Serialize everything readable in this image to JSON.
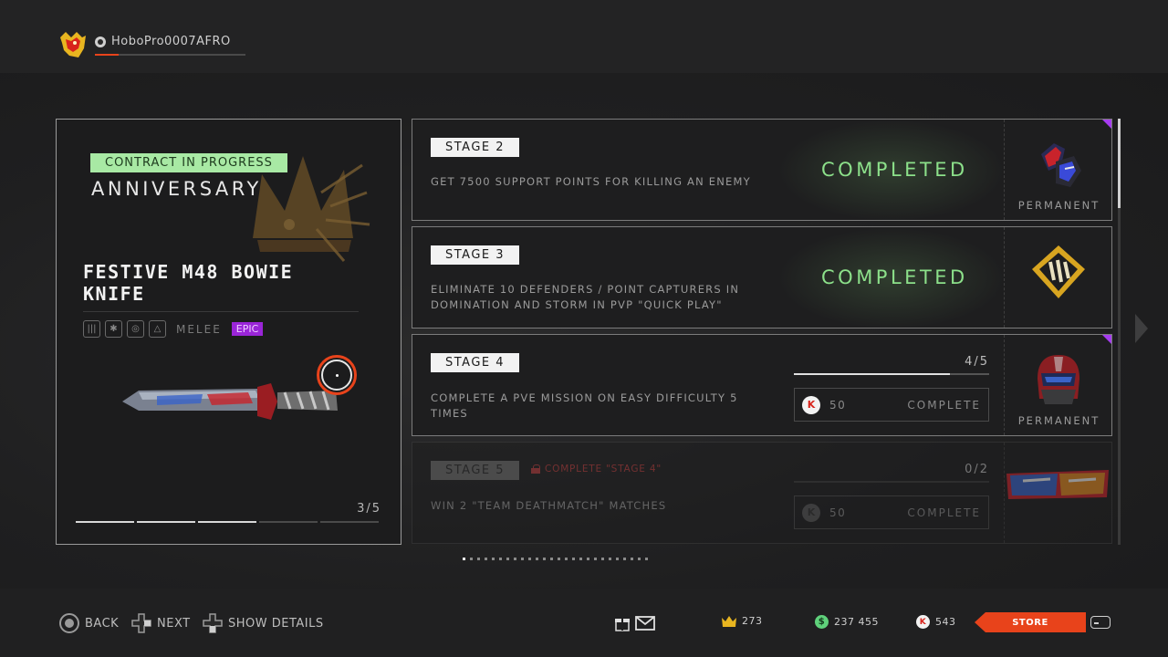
{
  "header": {
    "username": "HoboPro0007AFRO",
    "xp_progress": 0.16
  },
  "contract": {
    "status_badge": "CONTRACT IN PROGRESS",
    "event_name": "ANNIVERSARY",
    "item_name": "FESTIVE M48 BOWIE KNIFE",
    "item_type": "MELEE",
    "rarity": "EPIC",
    "rarity_color": "#9a25d8",
    "stage_counter": "3/5",
    "stages_completed": 3,
    "stages_total": 5
  },
  "stages": [
    {
      "label": "STAGE 2",
      "description": "GET 7500 SUPPORT POINTS FOR KILLING AN ENEMY",
      "status": "COMPLETED",
      "reward_icon": "gloves-icon",
      "reward_tag": "PERMANENT"
    },
    {
      "label": "STAGE 3",
      "description": "ELIMINATE 10 DEFENDERS / POINT CAPTURERS IN DOMINATION AND STORM IN PVP \"QUICK PLAY\"",
      "status": "COMPLETED",
      "reward_icon": "rank-badge-icon"
    },
    {
      "label": "STAGE 4",
      "description": "COMPLETE A PVE MISSION ON EASY DIFFICULTY 5 TIMES",
      "progress_text": "4/5",
      "progress_value": 0.8,
      "skip_cost": "50",
      "skip_action": "COMPLETE",
      "reward_icon": "helmet-icon",
      "reward_tag": "PERMANENT"
    },
    {
      "label": "STAGE 5",
      "lock_note": "COMPLETE \"STAGE 4\"",
      "description": "WIN 2 \"TEAM DEATHMATCH\" MATCHES",
      "progress_text": "0/2",
      "progress_value": 0,
      "skip_cost": "50",
      "skip_action": "COMPLETE",
      "reward_icon": "banner-icon"
    }
  ],
  "pager": {
    "count": 26,
    "active": 0
  },
  "footer": {
    "back": "BACK",
    "next": "NEXT",
    "show_details": "SHOW DETAILS",
    "crowns": "273",
    "credits": "237 455",
    "kredits": "543",
    "store": "STORE"
  },
  "colors": {
    "accent": "#e8431b",
    "completed": "#8ce08a",
    "badge": "#a8e9a4",
    "epic": "#9a25d8"
  }
}
